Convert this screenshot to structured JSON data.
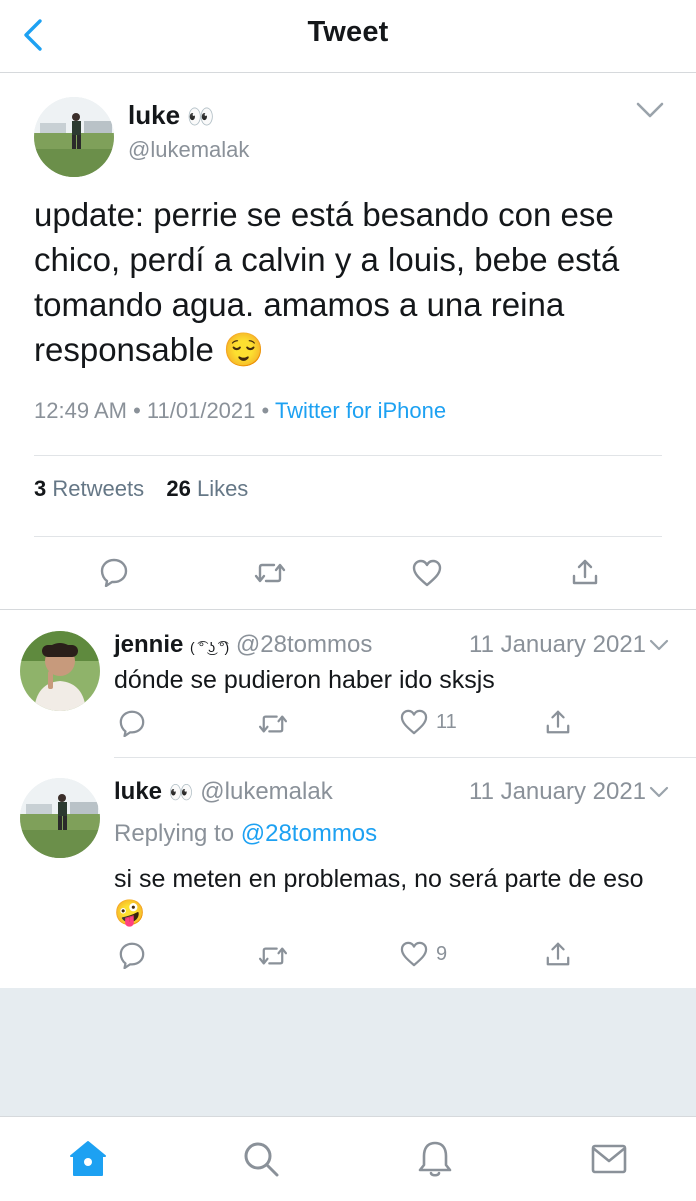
{
  "header": {
    "title": "Tweet",
    "back_icon": "chevron-left-icon"
  },
  "main_tweet": {
    "name": "luke",
    "name_emoji": "👀",
    "handle": "@lukemalak",
    "text": "update: perrie se está besando con ese chico, perdí a calvin y a louis, bebe está tomando agua. amamos a una reina responsable 😌",
    "time": "12:49 AM",
    "date": "11/01/2021",
    "source": "Twitter for iPhone",
    "retweets_count": "3",
    "retweets_label": "Retweets",
    "likes_count": "26",
    "likes_label": "Likes"
  },
  "replies": [
    {
      "name": "jennie",
      "name_emoji": "( ͡° ͜ʖ ͡°)",
      "handle": "@28tommos",
      "date": "11 January 2021",
      "text": "dónde se pudieron haber ido sksjs",
      "likes": "11"
    },
    {
      "name": "luke",
      "name_emoji": "👀",
      "handle": "@lukemalak",
      "date": "11 January 2021",
      "replying_label": "Replying to",
      "replying_to": "@28tommos",
      "text": "si se meten en problemas, no será parte de eso 🤪",
      "likes": "9"
    }
  ],
  "tabbar": {
    "items": [
      "home-icon",
      "search-icon",
      "notifications-icon",
      "messages-icon"
    ],
    "active_color": "#1da1f2"
  },
  "colors": {
    "accent": "#1da1f2",
    "muted": "#8a9199"
  }
}
